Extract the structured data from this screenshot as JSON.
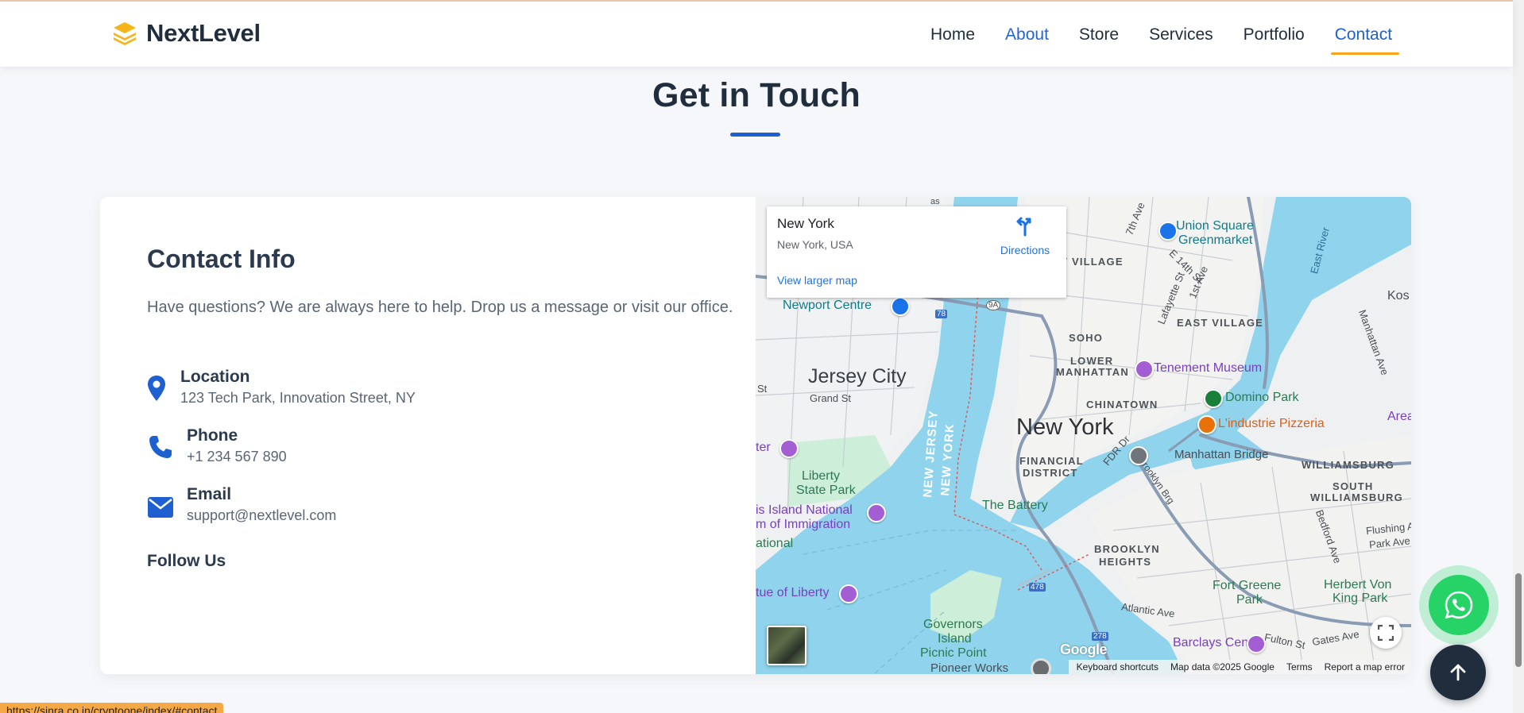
{
  "navbar": {
    "brand": "NextLevel",
    "links": [
      "Home",
      "About",
      "Store",
      "Services",
      "Portfolio",
      "Contact"
    ],
    "active": "Contact"
  },
  "section": {
    "title": "Get in Touch"
  },
  "contact": {
    "title": "Contact Info",
    "description": "Have questions? We are always here to help. Drop us a message or visit our office.",
    "location_label": "Location",
    "location_value": "123 Tech Park, Innovation Street, NY",
    "phone_label": "Phone",
    "phone_value": "+1 234 567 890",
    "email_label": "Email",
    "email_value": "support@nextlevel.com",
    "follow_label": "Follow Us"
  },
  "map": {
    "place_title": "New York",
    "place_sub": "New York, USA",
    "directions": "Directions",
    "view_larger": "View larger map",
    "footer": [
      "Keyboard shortcuts",
      "Map data ©2025 Google",
      "Terms",
      "Report a map error"
    ],
    "google": "Google",
    "labels": {
      "jersey_city": "Jersey City",
      "new_york": "New York",
      "newport_centre": "Newport Centre",
      "union_square": "Union Square",
      "greenmarket": "Greenmarket",
      "east_village": "EAST VILLAGE",
      "t_village": "T VILLAGE",
      "soho": "SOHO",
      "lower": "LOWER",
      "manhattan": "MANHATTAN",
      "tenement": "Tenement Museum",
      "chinatown": "CHINATOWN",
      "domino": "Domino Park",
      "lindustrie": "L'industrie Pizzeria",
      "area": "Area",
      "financial": "FINANCIAL",
      "district": "DISTRICT",
      "manhattan_bridge": "Manhattan Bridge",
      "williamsburg": "WILLIAMSBURG",
      "south": "SOUTH",
      "s_williamsburg": "WILLIAMSBURG",
      "grand_st": "Grand St",
      "liberty": "Liberty",
      "state_park": "State Park",
      "ellis1": "is Island National",
      "ellis2": "m of Immigration",
      "ational": "ational",
      "the_battery": "The Battery",
      "brooklyn": "BROOKLYN",
      "heights": "HEIGHTS",
      "statue": "tue of Liberty",
      "fort_greene": "Fort Greene",
      "park": "Park",
      "herbert": "Herbert Von",
      "king_park": "King Park",
      "governors": "Governors",
      "island": "Island",
      "picnic": "Picnic Point",
      "barclays": "Barclays Center",
      "pioneer": "Pioneer Works",
      "new_jersey": "NEW JERSEY",
      "new_york_line": "NEW YORK",
      "atlantic": "Atlantic Ave",
      "fulton": "Fulton St",
      "gates": "Gates Ave",
      "flushing": "Flushing A",
      "park_ave": "Park Ave",
      "bedford": "Bedford Ave",
      "fdr": "FDR Dr",
      "brooklyn_bq": "Brooklyn Brg",
      "lafayette": "Lafayette St",
      "first_ave": "1st Ave",
      "e14": "E 14th St",
      "seventh": "7th Ave",
      "east_river": "East River",
      "manhattan_ave": "Manhattan Ave",
      "kos": "Kos",
      "st": "St",
      "ter": "ter",
      "r78": "78",
      "r9a": "9A",
      "r478": "478",
      "r278": "278",
      "as": "as"
    }
  },
  "status_url": "https://sinra.co.in/cryptoone/index/#contact",
  "colors": {
    "brand_yellow": "#f4b41a",
    "accent_blue": "#1e60d0",
    "nav_underline": "#f4a51c",
    "dark_navy": "#1f2d3d",
    "whatsapp_green": "#25d366",
    "water": "#8fd3ec"
  },
  "icons": {
    "logo": "layers-icon",
    "location": "map-pin-icon",
    "phone": "phone-icon",
    "email": "envelope-icon",
    "whatsapp": "whatsapp-icon",
    "scroll": "arrow-up-icon"
  }
}
